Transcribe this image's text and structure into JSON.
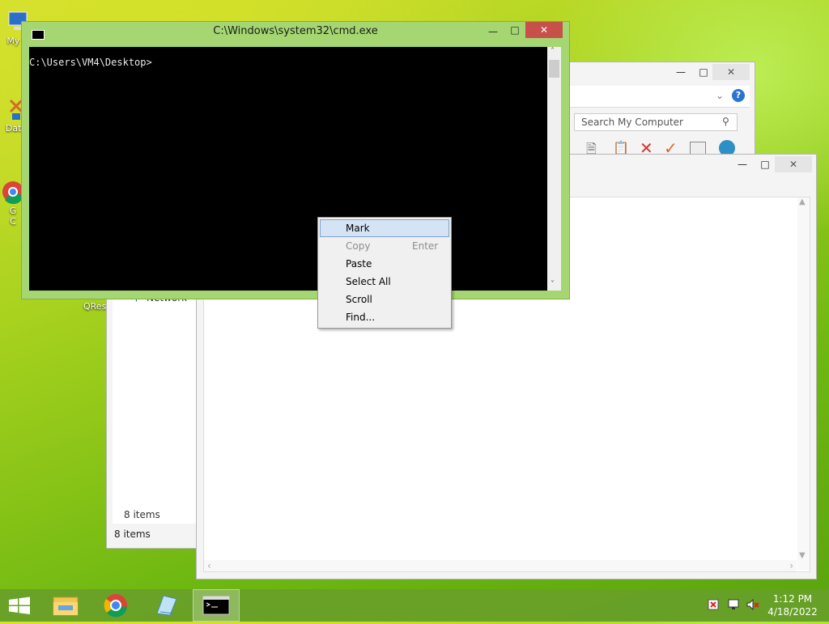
{
  "desktop": {
    "icons": [
      {
        "label": "My C",
        "icon": "computer-icon"
      },
      {
        "label": "Data",
        "icon": "shortcut-icon"
      },
      {
        "label": "G",
        "icon": "chrome-icon"
      },
      {
        "label": "C",
        "icon": "shortcut-icon"
      },
      {
        "label": "QRes",
        "icon": "shortcut-icon"
      }
    ]
  },
  "explorer_back": {
    "search_placeholder": "Search My Computer",
    "nav_item": "Network",
    "status_inner": "8 items",
    "status_outer": "8 items"
  },
  "cmd": {
    "title": "C:\\Windows\\system32\\cmd.exe",
    "prompt": "C:\\Users\\VM4\\Desktop>"
  },
  "context_menu": {
    "items": [
      {
        "label": "Mark",
        "shortcut": "",
        "state": "highlighted"
      },
      {
        "label": "Copy",
        "shortcut": "Enter",
        "state": "disabled"
      },
      {
        "label": "Paste",
        "shortcut": "",
        "state": "normal"
      },
      {
        "label": "Select All",
        "shortcut": "",
        "state": "normal"
      },
      {
        "label": "Scroll",
        "shortcut": "",
        "state": "normal"
      },
      {
        "label": "Find...",
        "shortcut": "",
        "state": "normal"
      }
    ]
  },
  "taskbar": {
    "apps": [
      {
        "name": "start-button"
      },
      {
        "name": "file-explorer"
      },
      {
        "name": "chrome"
      },
      {
        "name": "notepad"
      },
      {
        "name": "cmd",
        "active": true
      }
    ],
    "time": "1:12 PM",
    "date": "4/18/2022"
  },
  "colors": {
    "window_frame": "#a5d671",
    "close_button": "#c7504b",
    "menu_highlight": "#d5e4f4"
  }
}
